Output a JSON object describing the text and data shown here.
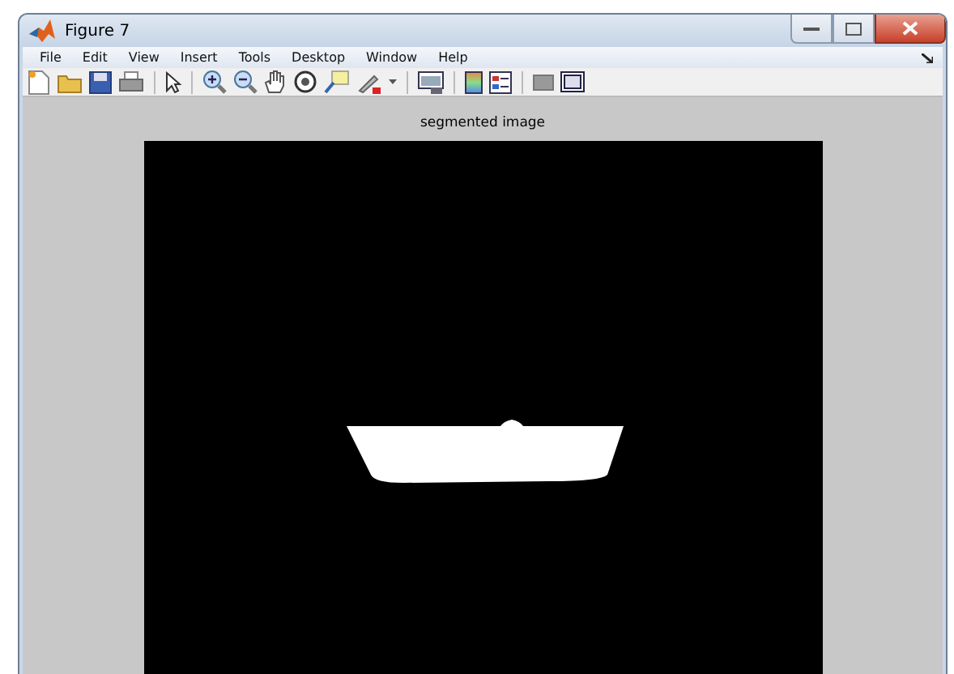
{
  "window": {
    "title": "Figure 7"
  },
  "menu": [
    "File",
    "Edit",
    "View",
    "Insert",
    "Tools",
    "Desktop",
    "Window",
    "Help"
  ],
  "axes": {
    "title": "segmented image"
  }
}
